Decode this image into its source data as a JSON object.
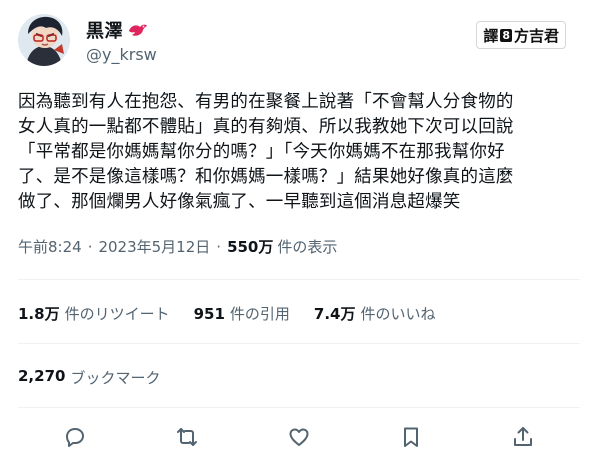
{
  "user": {
    "display_name": "黒澤",
    "handle": "@y_krsw"
  },
  "translator_badge": {
    "left": "譯",
    "mid": "8",
    "right": "方吉君"
  },
  "tweet": {
    "text": "因為聽到有人在抱怨、有男的在聚餐上說著「不會幫人分食物的\n女人真的一點都不體貼」真的有夠煩、所以我教她下次可以回說\n「平常都是你媽媽幫你分的嗎？」「今天你媽媽不在那我幫你好\n了、是不是像這樣嗎？和你媽媽一樣嗎？」結果她好像真的這麼\n做了、那個爛男人好像氣瘋了、一早聽到這個消息超爆笑",
    "time": "午前8:24",
    "date": "2023年5月12日",
    "views_count": "550万",
    "views_label": "件の表示"
  },
  "stats": {
    "retweets_count": "1.8万",
    "retweets_label": "件のリツイート",
    "quotes_count": "951",
    "quotes_label": "件の引用",
    "likes_count": "7.4万",
    "likes_label": "件のいいね",
    "bookmarks_count": "2,270",
    "bookmarks_label": "ブックマーク"
  },
  "actions": [
    "reply-icon",
    "retweet-icon",
    "like-icon",
    "bookmark-icon",
    "share-icon"
  ],
  "colors": {
    "text": "#0f1419",
    "secondary": "#536471",
    "divider": "#eff3f4"
  }
}
